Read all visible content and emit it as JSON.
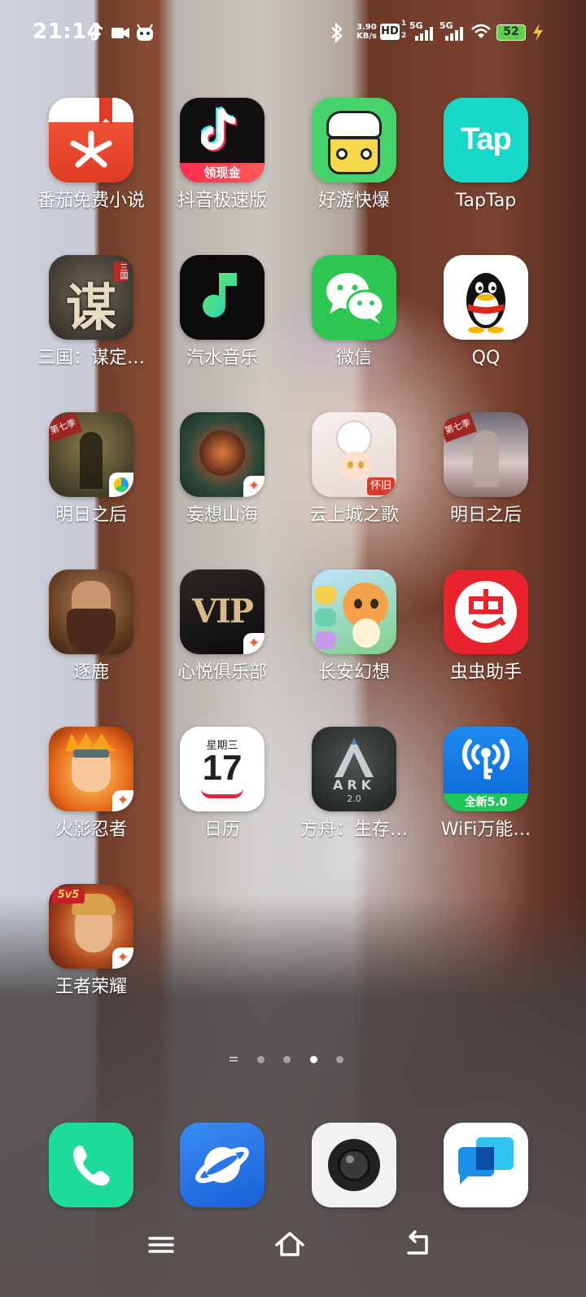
{
  "status_bar": {
    "time": "21:14",
    "net_speed_value": "3.90",
    "net_speed_unit": "KB/s",
    "hd_badge": "HD",
    "sim_badges": [
      "1",
      "2"
    ],
    "network_types": [
      "5G",
      "5G"
    ],
    "battery_level": "52",
    "icons": [
      "tiktok-notify-icon",
      "video-icon",
      "android-icon",
      "bluetooth-icon",
      "hd-volte-icon",
      "signal-icon",
      "wifi-icon",
      "battery-icon",
      "charging-icon"
    ]
  },
  "apps": [
    {
      "label": "番茄免费小说",
      "icon": "tomato-novel-icon"
    },
    {
      "label": "抖音极速版",
      "icon": "douyin-lite-icon",
      "badge": "领现金"
    },
    {
      "label": "好游快爆",
      "icon": "haoyou-kuaibao-icon"
    },
    {
      "label": "TapTap",
      "icon": "taptap-icon",
      "icon_text": "Tap"
    },
    {
      "label": "三国：谋定…",
      "icon": "sanguo-moudingtianxia-icon",
      "icon_text": "谋",
      "corner_text": "三国"
    },
    {
      "label": "汽水音乐",
      "icon": "qishui-music-icon"
    },
    {
      "label": "微信",
      "icon": "wechat-icon"
    },
    {
      "label": "QQ",
      "icon": "qq-icon"
    },
    {
      "label": "明日之后",
      "icon": "lifeafter-icon",
      "corner_text": "第七季"
    },
    {
      "label": "妄想山海",
      "icon": "wangxiang-shanhai-icon"
    },
    {
      "label": "云上城之歌",
      "icon": "yunshangcheng-icon",
      "badge": "怀旧"
    },
    {
      "label": "明日之后",
      "icon": "lifeafter-2-icon",
      "corner_text": "第七季"
    },
    {
      "label": "逐鹿",
      "icon": "zhulu-icon"
    },
    {
      "label": "心悦俱乐部",
      "icon": "xinyue-club-icon",
      "icon_text": "VIP"
    },
    {
      "label": "长安幻想",
      "icon": "changan-huanxiang-icon"
    },
    {
      "label": "虫虫助手",
      "icon": "chongchong-helper-icon"
    },
    {
      "label": "火影忍者",
      "icon": "naruto-icon"
    },
    {
      "label": "日历",
      "icon": "calendar-icon",
      "weekday": "星期三",
      "day": "17"
    },
    {
      "label": "方舟：生存…",
      "icon": "ark-survival-icon",
      "icon_text": "ARK",
      "sub_text": "2.0"
    },
    {
      "label": "WiFi万能…",
      "icon": "wifi-master-key-icon",
      "badge": "全新5.0"
    },
    {
      "label": "王者荣耀",
      "icon": "honor-of-kings-icon",
      "corner_text": "5v5"
    }
  ],
  "page_indicator": {
    "pages": 4,
    "active_index": 2
  },
  "dock": [
    {
      "name": "phone",
      "icon": "phone-icon"
    },
    {
      "name": "browser",
      "icon": "browser-icon"
    },
    {
      "name": "camera",
      "icon": "camera-icon"
    },
    {
      "name": "messages",
      "icon": "messages-icon"
    }
  ],
  "nav_bar": [
    "menu-icon",
    "home-icon",
    "back-icon"
  ]
}
